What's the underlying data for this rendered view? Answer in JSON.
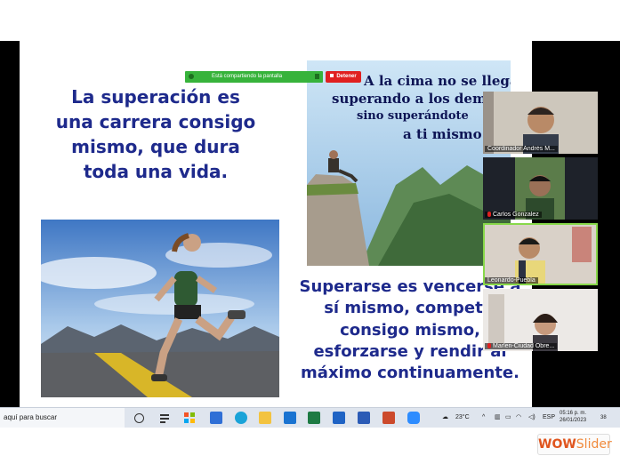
{
  "share_bar": {
    "text": "Está compartiendo la pantalla",
    "stop_label": "Detener"
  },
  "slide": {
    "left_text": "La superación es una carrera consigo mismo, que dura toda una vida.",
    "right_text": "Superarse es vencerse a sí mismo, competir consigo mismo, esforzarse y rendir al máximo continuamente.",
    "quote": {
      "line1": "A la cima no se llega",
      "line2": "superando a los demás",
      "line3": "sino superándote",
      "line4": "a ti mismo"
    }
  },
  "participants": [
    {
      "name": "Coordinador Andrés M...",
      "muted": false,
      "active": false
    },
    {
      "name": "Carlos Gonzalez",
      "muted": true,
      "active": false
    },
    {
      "name": "Leonardo-Puebla",
      "muted": false,
      "active": true
    },
    {
      "name": "Marlen-Ciudad Obre...",
      "muted": true,
      "active": false
    }
  ],
  "taskbar": {
    "search_text": "aquí para buscar",
    "temperature": "23°C",
    "language": "ESP",
    "time": "05:16 p. m.",
    "date": "26/01/2023",
    "notification_count": "38",
    "apps": [
      "task-view",
      "widgets",
      "calendar",
      "edge",
      "file-explorer",
      "mail",
      "excel",
      "outlook",
      "word",
      "powerpoint",
      "zoom"
    ]
  },
  "watermark": {
    "brand": "WOW",
    "suffix": "Slider"
  },
  "colors": {
    "slide_text": "#1e2a8c",
    "share_green": "#37b33b",
    "stop_red": "#e02020",
    "active_tile": "#88d84a",
    "taskbar": "#dfe5ee"
  }
}
